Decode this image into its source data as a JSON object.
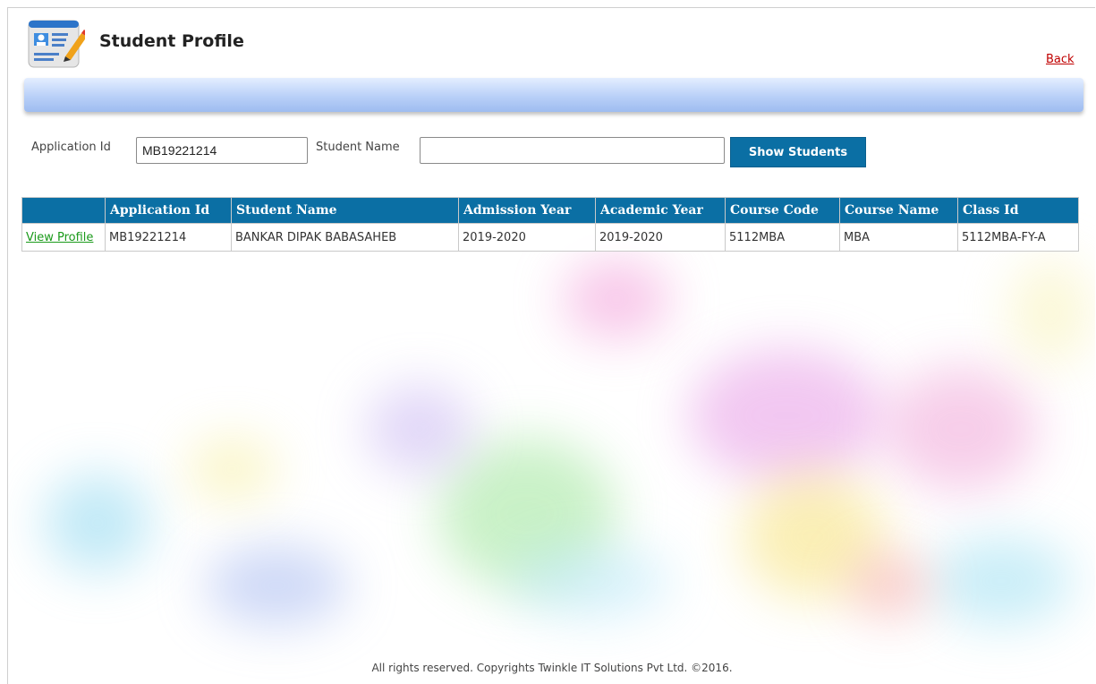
{
  "header": {
    "title": "Student Profile",
    "back_label": "Back",
    "icon": "profile-form-icon"
  },
  "search": {
    "application_id_label": "Application Id",
    "application_id_value": "MB19221214",
    "student_name_label": "Student Name",
    "student_name_value": "",
    "show_students_label": "Show Students"
  },
  "table": {
    "columns": [
      "",
      "Application Id",
      "Student Name",
      "Admission Year",
      "Academic Year",
      "Course Code",
      "Course Name",
      "Class Id"
    ],
    "rows": [
      {
        "action": "View Profile",
        "application_id": "MB19221214",
        "student_name": "BANKAR DIPAK BABASAHEB",
        "admission_year": "2019-2020",
        "academic_year": "2019-2020",
        "course_code": "5112MBA",
        "course_name": "MBA",
        "class_id": "5112MBA-FY-A"
      }
    ]
  },
  "footer": {
    "text": "All rights reserved. Copyrights Twinkle IT Solutions Pvt Ltd. ©2016."
  },
  "colors": {
    "header_blue": "#0b6fa4",
    "back_link": "#c00000",
    "view_link": "#1a9a1a",
    "bar_gradient_top": "#e4eeff",
    "bar_gradient_bottom": "#9ebcf0"
  }
}
